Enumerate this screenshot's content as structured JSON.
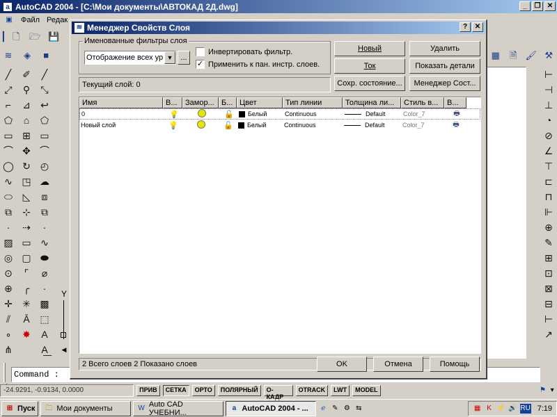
{
  "app": {
    "title": "AutoCAD 2004 - [C:\\Мои документы\\АВТОКАД 2Д.dwg]",
    "menu": [
      "Файл",
      "Редак"
    ]
  },
  "dialog": {
    "title": "Менеджер Свойств Слоя",
    "filters_group_label": "Именованные фильтры слоя",
    "filter_value": "Отображение всех ур",
    "filter_browse": "...",
    "invert_filter_label": "Инвертировать фильтр.",
    "invert_filter_checked": false,
    "apply_toolbar_label": "Применить к пан. инстр. слоев.",
    "apply_toolbar_checked": true,
    "buttons": {
      "new": "Новый",
      "delete": "Удалить",
      "current": "Ток",
      "show_details": "Показать детали",
      "save_state": "Сохр. состояние...",
      "state_manager": "Менеджер Сост...",
      "ok": "OK",
      "cancel": "Отмена",
      "help": "Помощь"
    },
    "current_layer": "Текущий слой:  0",
    "columns": [
      "Имя",
      "В...",
      "Замор...",
      "Б...",
      "Цвет",
      "Тип линии",
      "Толщина ли...",
      "Стиль в...",
      "В..."
    ],
    "rows": [
      {
        "name": "0",
        "color": "Белый",
        "linetype": "Continuous",
        "lineweight": "Default",
        "plotstyle": "Color_7"
      },
      {
        "name": "Новый слой",
        "color": "Белый",
        "linetype": "Continuous",
        "lineweight": "Default",
        "plotstyle": "Color_7"
      }
    ],
    "layer_count": "2 Всего слоев   2 Показано слоев"
  },
  "command_line": "Command :",
  "status": {
    "coords": "-24.9291, -0.9134, 0.0000",
    "modes": [
      {
        "label": "ПРИВ",
        "on": false
      },
      {
        "label": "СЕТКА",
        "on": true
      },
      {
        "label": "ОРТО",
        "on": false
      },
      {
        "label": "ПОЛЯРНЫЙ",
        "on": false
      },
      {
        "label": "О-КАДР",
        "on": false
      },
      {
        "label": "OTRACK",
        "on": false
      },
      {
        "label": "LWT",
        "on": false
      },
      {
        "label": "MODEL",
        "on": false
      }
    ]
  },
  "taskbar": {
    "start": "Пуск",
    "tasks": [
      {
        "label": "Мои документы",
        "icon": "folder-icon",
        "active": false
      },
      {
        "label": "Auto CAD УЧЕБНИ...",
        "icon": "word-icon",
        "active": false
      },
      {
        "label": "AutoCAD 2004 - ...",
        "icon": "autocad-icon",
        "active": true
      }
    ],
    "lang": "RU",
    "time": "7:19"
  },
  "drawing": {
    "ucs_label": "Y"
  },
  "colors": {
    "titlebar_start": "#0a246a",
    "titlebar_end": "#a6caf0",
    "face": "#d4d0c8"
  }
}
